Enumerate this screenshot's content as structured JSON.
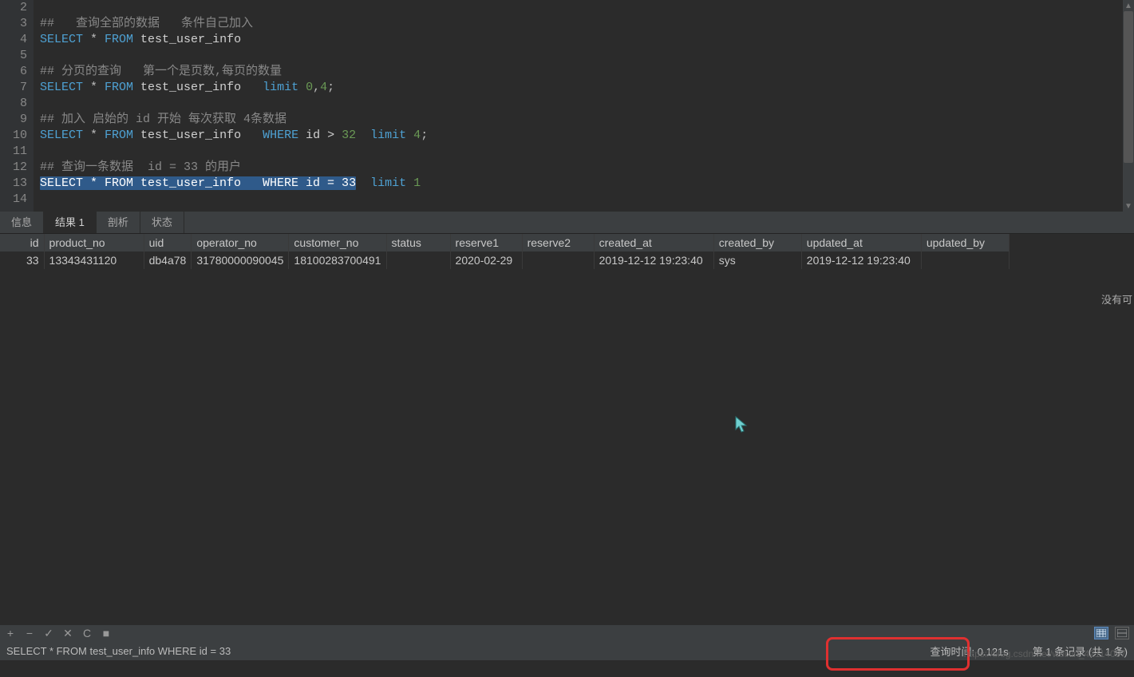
{
  "editor": {
    "line_numbers": [
      "2",
      "3",
      "4",
      "5",
      "6",
      "7",
      "8",
      "9",
      "10",
      "11",
      "12",
      "13",
      "14"
    ],
    "lines": [
      {
        "tokens": []
      },
      {
        "tokens": [
          {
            "t": "##   查询全部的数据   条件自己加入",
            "c": "comment"
          }
        ]
      },
      {
        "tokens": [
          {
            "t": "SELECT",
            "c": "kw"
          },
          {
            "t": " * ",
            "c": "star"
          },
          {
            "t": "FROM",
            "c": "kw"
          },
          {
            "t": " test_user_info",
            "c": "ident"
          }
        ]
      },
      {
        "tokens": []
      },
      {
        "tokens": [
          {
            "t": "## 分页的查询   第一个是页数,每页的数量",
            "c": "comment"
          }
        ]
      },
      {
        "tokens": [
          {
            "t": "SELECT",
            "c": "kw"
          },
          {
            "t": " * ",
            "c": "star"
          },
          {
            "t": "FROM",
            "c": "kw"
          },
          {
            "t": " test_user_info   ",
            "c": "ident"
          },
          {
            "t": "limit",
            "c": "kw"
          },
          {
            "t": " ",
            "c": "op"
          },
          {
            "t": "0",
            "c": "num"
          },
          {
            "t": ",",
            "c": "op"
          },
          {
            "t": "4",
            "c": "num"
          },
          {
            "t": ";",
            "c": "op"
          }
        ]
      },
      {
        "tokens": []
      },
      {
        "tokens": [
          {
            "t": "## 加入 启始的 id 开始 每次获取 4条数据",
            "c": "comment"
          }
        ]
      },
      {
        "tokens": [
          {
            "t": "SELECT",
            "c": "kw"
          },
          {
            "t": " * ",
            "c": "star"
          },
          {
            "t": "FROM",
            "c": "kw"
          },
          {
            "t": " test_user_info   ",
            "c": "ident"
          },
          {
            "t": "WHERE",
            "c": "kw"
          },
          {
            "t": " id > ",
            "c": "ident"
          },
          {
            "t": "32",
            "c": "num"
          },
          {
            "t": "  ",
            "c": "op"
          },
          {
            "t": "limit",
            "c": "kw"
          },
          {
            "t": " ",
            "c": "op"
          },
          {
            "t": "4",
            "c": "num"
          },
          {
            "t": ";",
            "c": "op"
          }
        ]
      },
      {
        "tokens": []
      },
      {
        "tokens": [
          {
            "t": "## 查询一条数据  id = 33 的用户",
            "c": "comment"
          }
        ]
      },
      {
        "tokens": [
          {
            "t": "SELECT * FROM test_user_info   WHERE id = 33",
            "c": "sel"
          },
          {
            "t": "  ",
            "c": "op"
          },
          {
            "t": "limit",
            "c": "kw"
          },
          {
            "t": " ",
            "c": "op"
          },
          {
            "t": "1",
            "c": "num"
          }
        ]
      },
      {
        "tokens": []
      }
    ]
  },
  "tabs": {
    "items": [
      {
        "label": "信息",
        "active": false
      },
      {
        "label": "结果 1",
        "active": true
      },
      {
        "label": "剖析",
        "active": false
      },
      {
        "label": "状态",
        "active": false
      }
    ]
  },
  "results": {
    "columns": [
      "id",
      "product_no",
      "uid",
      "operator_no",
      "customer_no",
      "status",
      "reserve1",
      "reserve2",
      "created_at",
      "created_by",
      "updated_at",
      "updated_by"
    ],
    "col_classes": [
      "c-id",
      "c-product",
      "c-uid",
      "c-operator",
      "c-customer",
      "c-status",
      "c-reserve1",
      "c-reserve2",
      "c-created_at",
      "c-created_by",
      "c-updated_at",
      "c-updated_by"
    ],
    "rows": [
      [
        "33",
        "13343431120",
        "db4a78",
        "31780000090045",
        "18100283700491",
        "",
        "2020-02-29",
        "",
        "2019-12-12 19:23:40",
        "sys",
        "2019-12-12 19:23:40",
        ""
      ]
    ],
    "side_text": "没有可"
  },
  "toolbar": {
    "add": "+",
    "remove": "−",
    "check": "✓",
    "close": "✕",
    "refresh": "C",
    "stop": "■"
  },
  "statusbar": {
    "sql": "SELECT * FROM test_user_info   WHERE id = 33",
    "query_time": "查询时间: 0.121s",
    "record_info": "第 1 条记录 (共 1 条)"
  },
  "watermark": "https://blog.csdn.net/weixin_42114097"
}
